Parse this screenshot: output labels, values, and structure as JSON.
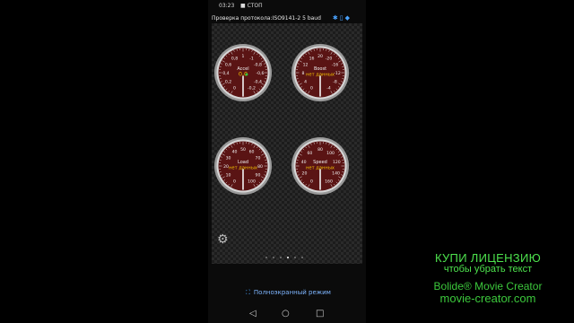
{
  "status_bar": {
    "time": "03:23",
    "recording": "■ СТОП"
  },
  "protocol_bar": {
    "text": "Проверка протокола:ISO9141-2 5 baud",
    "icons": [
      "bluetooth-icon",
      "phone-icon",
      "pin-icon"
    ]
  },
  "gauges": [
    {
      "name": "Accel",
      "value_text": "0,0",
      "ticks": [
        "1",
        "0,8",
        "-1",
        "0,6",
        "-0,8",
        "0,4",
        "-0,6",
        "0,2",
        "-0,4",
        "0",
        "-0,2"
      ],
      "needle_value": 0.0
    },
    {
      "name": "Boost",
      "value_text": "нет данных",
      "ticks": [
        "20",
        "16",
        "-20",
        "12",
        "-16",
        "8",
        "-12",
        "4",
        "-8",
        "0",
        "-4"
      ]
    },
    {
      "name": "Load",
      "value_text": "нет данных",
      "ticks": [
        "50",
        "40",
        "60",
        "30",
        "70",
        "20",
        "80",
        "10",
        "90",
        "0",
        "100"
      ]
    },
    {
      "name": "Speed",
      "value_text": "нет данных",
      "ticks": [
        "80",
        "60",
        "100",
        "40",
        "120",
        "20",
        "140",
        "0",
        "160"
      ]
    }
  ],
  "pager": {
    "count": 6,
    "active_index": 3
  },
  "fullscreen": {
    "label": "Полноэкранный режим"
  },
  "navbar": {
    "back": "◁",
    "home": "○",
    "recents": "□"
  },
  "watermark": {
    "line1": "КУПИ ЛИЦЕНЗИЮ",
    "line2": "чтобы убрать текст",
    "line3": "Bolide® Movie Creator",
    "line4": "movie-creator.com"
  },
  "colors": {
    "gauge_face": "#5a1414",
    "value_text": "#f2c200",
    "link": "#4aa3ff",
    "watermark": "#4de24d"
  }
}
